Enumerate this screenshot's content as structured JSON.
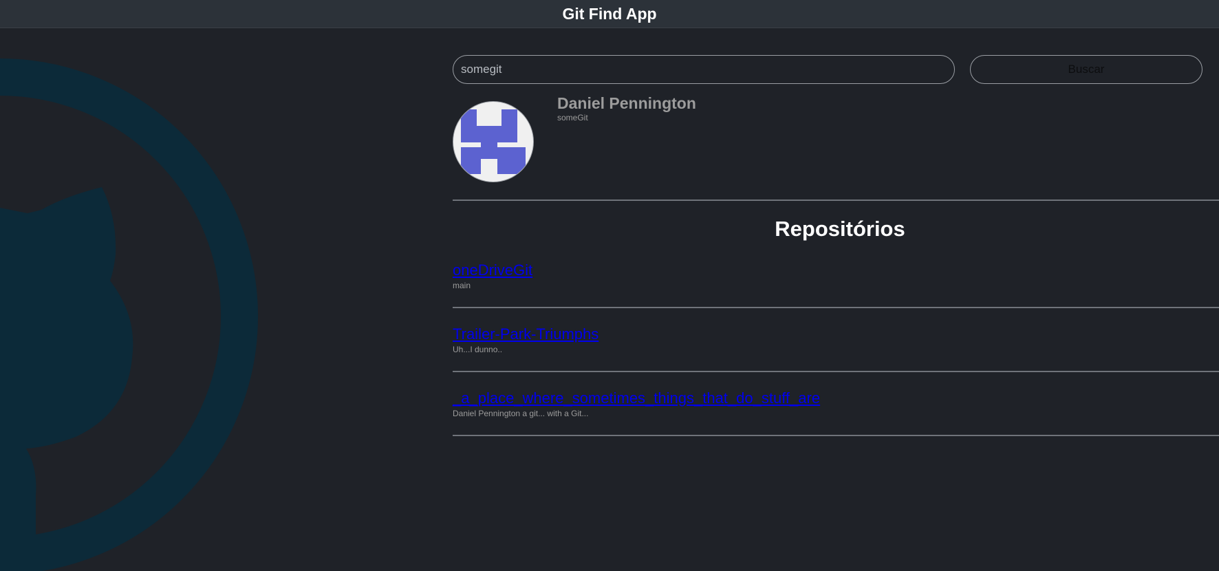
{
  "header": {
    "title": "Git Find App"
  },
  "search": {
    "value": "somegit",
    "button_label": "Buscar"
  },
  "user": {
    "name": "Daniel Pennington",
    "login": "someGit"
  },
  "repositories": {
    "heading": "Repositórios",
    "items": [
      {
        "name": "oneDriveGit",
        "description": "main"
      },
      {
        "name": "Trailer-Park-Triumphs",
        "description": "Uh...I dunno.."
      },
      {
        "name": "_a_place_where_sometimes_things_that_do_stuff_are",
        "description": "Daniel Pennington a git... with a Git..."
      }
    ]
  },
  "colors": {
    "background": "#1f2228",
    "header_bg": "#2c3239",
    "link": "#0000ee",
    "muted_text": "#9c9c9c",
    "logo_watermark": "#0c2a39",
    "avatar_pattern": "#5c62d0"
  },
  "icons": {
    "background_logo": "github-octocat-logo-icon",
    "avatar": "identicon-avatar"
  }
}
